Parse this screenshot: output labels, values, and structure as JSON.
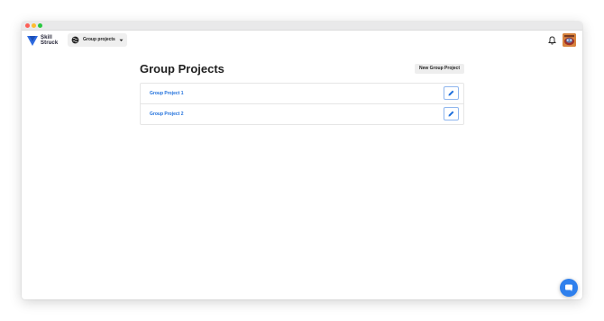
{
  "brand": {
    "line1": "Skill",
    "line2": "Struck",
    "color": "#2f6be0"
  },
  "group_selector": {
    "label": "Group projects",
    "icon": "globe-icon"
  },
  "header": {
    "notifications_icon": "bell-icon",
    "avatar_icon": "avatar"
  },
  "main": {
    "title": "Group Projects",
    "new_button_label": "New Group Project",
    "projects": [
      {
        "name": "Group Project 1",
        "edit_icon": "pencil-icon"
      },
      {
        "name": "Group Project 2",
        "edit_icon": "pencil-icon"
      }
    ]
  },
  "chat": {
    "icon": "chat-icon",
    "color": "#2f80ed"
  },
  "colors": {
    "link": "#1e6fdc",
    "accent": "#2f80ed"
  }
}
